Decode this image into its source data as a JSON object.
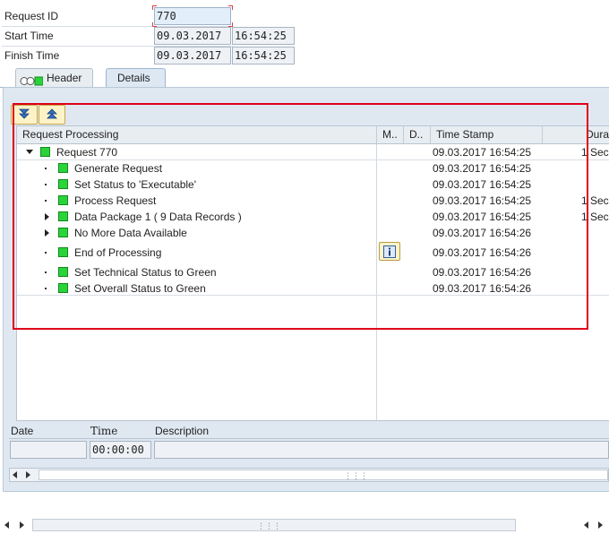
{
  "fields": {
    "request_id": {
      "label": "Request ID",
      "value": "770"
    },
    "start_time": {
      "label": "Start Time",
      "date": "09.03.2017",
      "time": "16:54:25"
    },
    "finish_time": {
      "label": "Finish Time",
      "date": "09.03.2017",
      "time": "16:54:25"
    }
  },
  "tabs": [
    {
      "label": "Header",
      "active": false
    },
    {
      "label": "Details",
      "active": true
    }
  ],
  "toolbar": {
    "expand_icon": "expand-all-icon",
    "collapse_icon": "collapse-all-icon"
  },
  "table": {
    "headers": [
      "Request Processing",
      "M..",
      "D..",
      "Time Stamp",
      "Durat"
    ],
    "rows": [
      {
        "level": 0,
        "expander": "open",
        "label": "Request 770",
        "timestamp": "09.03.2017 16:54:25",
        "duration": "1 Sec"
      },
      {
        "level": 1,
        "expander": "bullet",
        "label": "Generate Request",
        "timestamp": "09.03.2017 16:54:25",
        "duration": ""
      },
      {
        "level": 1,
        "expander": "bullet",
        "label": "Set Status to 'Executable'",
        "timestamp": "09.03.2017 16:54:25",
        "duration": ""
      },
      {
        "level": 1,
        "expander": "bullet",
        "label": "Process Request",
        "timestamp": "09.03.2017 16:54:25",
        "duration": "1 Sec"
      },
      {
        "level": 1,
        "expander": "closed",
        "label": "Data Package 1 ( 9 Data Records )",
        "timestamp": "09.03.2017 16:54:25",
        "duration": "1 Sec"
      },
      {
        "level": 1,
        "expander": "closed",
        "label": "No More Data Available",
        "timestamp": "09.03.2017 16:54:26",
        "duration": ""
      },
      {
        "level": 1,
        "expander": "bullet",
        "label": "End of Processing",
        "timestamp": "09.03.2017 16:54:26",
        "duration": "",
        "message_icon": "info-icon"
      },
      {
        "level": 1,
        "expander": "bullet",
        "label": "Set Technical Status to Green",
        "timestamp": "09.03.2017 16:54:26",
        "duration": ""
      },
      {
        "level": 1,
        "expander": "bullet",
        "label": "Set Overall Status to Green",
        "timestamp": "09.03.2017 16:54:26",
        "duration": ""
      }
    ]
  },
  "details": {
    "date_label": "Date",
    "time_label": "Time",
    "description_label": "Description",
    "date_value": "",
    "time_value": "00:00:00",
    "description_value": ""
  },
  "colors": {
    "status_green": "#2bd33a",
    "highlight_box": "#e0001a",
    "button_yellow": "#fdf3c7"
  }
}
